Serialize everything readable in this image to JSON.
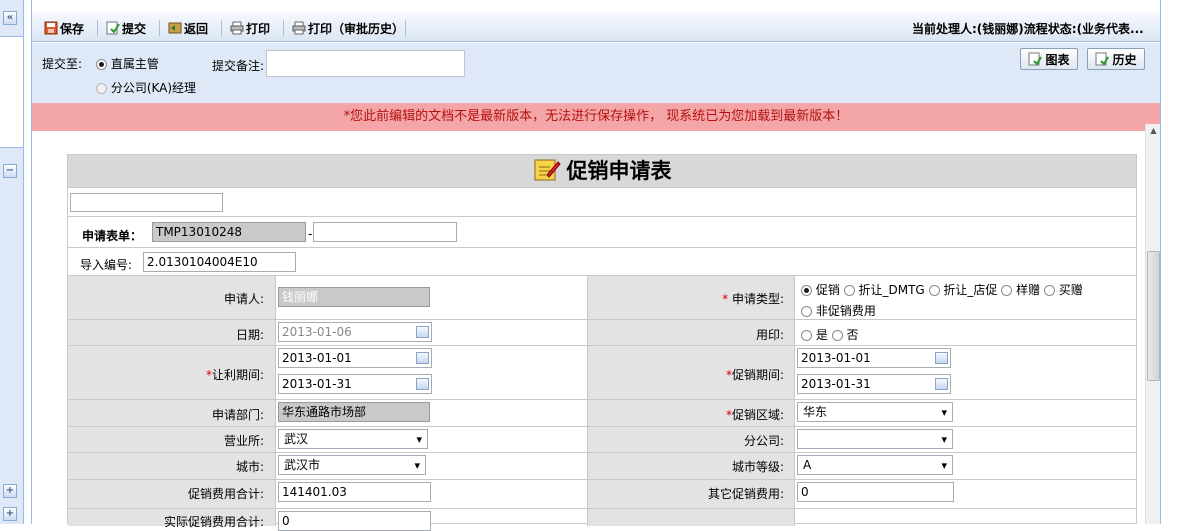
{
  "toolbar": {
    "save": "保存",
    "submit": "提交",
    "back": "返回",
    "print": "打印",
    "print_history": "打印（审批历史）",
    "status": "当前处理人:(钱丽娜)流程状态:(业务代表..."
  },
  "submit_area": {
    "submit_to_label": "提交至:",
    "option1": "直属主管",
    "option2": "分公司(KA)经理",
    "remark_label": "提交备注:",
    "remark_value": "",
    "chart_button": "图表",
    "history_button": "历史"
  },
  "warning": "*您此前编辑的文档不是最新版本，无法进行保存操作， 现系统已为您加载到最新版本！",
  "form": {
    "title": "促销申请表",
    "top_input": "",
    "form_no_label": "申请表单：",
    "form_no_value": "TMP13010248",
    "form_no_sep": "-",
    "form_no_suffix": "",
    "import_label": "导入编号:",
    "import_value": "2.0130104004E10",
    "applicant_label": "申请人:",
    "applicant_value": "钱丽娜",
    "type_label": "申请类型:",
    "type_options": [
      "促销",
      "折让_DMTG",
      "折让_店促",
      "样赠",
      "买赠",
      "非促销费用"
    ],
    "date_label": "日期:",
    "date_value": "2013-01-06",
    "seal_label": "用印:",
    "seal_yes": "是",
    "seal_no": "否",
    "discount_period_label": "让利期间:",
    "discount_start": "2013-01-01",
    "discount_end": "2013-01-31",
    "promo_period_label": "促销期间:",
    "promo_start": "2013-01-01",
    "promo_end": "2013-01-31",
    "dept_label": "申请部门:",
    "dept_value": "华东通路市场部",
    "region_label": "促销区域:",
    "region_value": "华东",
    "office_label": "营业所:",
    "office_value": "武汉",
    "branch_label": "分公司:",
    "branch_value": "",
    "city_label": "城市:",
    "city_value": "武汉市",
    "city_level_label": "城市等级:",
    "city_level_value": "A",
    "promo_total_label": "促销费用合计:",
    "promo_total_value": "141401.03",
    "other_cost_label": "其它促销费用:",
    "other_cost_value": "0",
    "actual_total_label": "实际促销费用合计:",
    "actual_total_value": "0"
  },
  "colors": {
    "warning_bg": "#f4a5a8",
    "warning_text": "#b3120f",
    "panel_bg": "#dfe8f6"
  }
}
